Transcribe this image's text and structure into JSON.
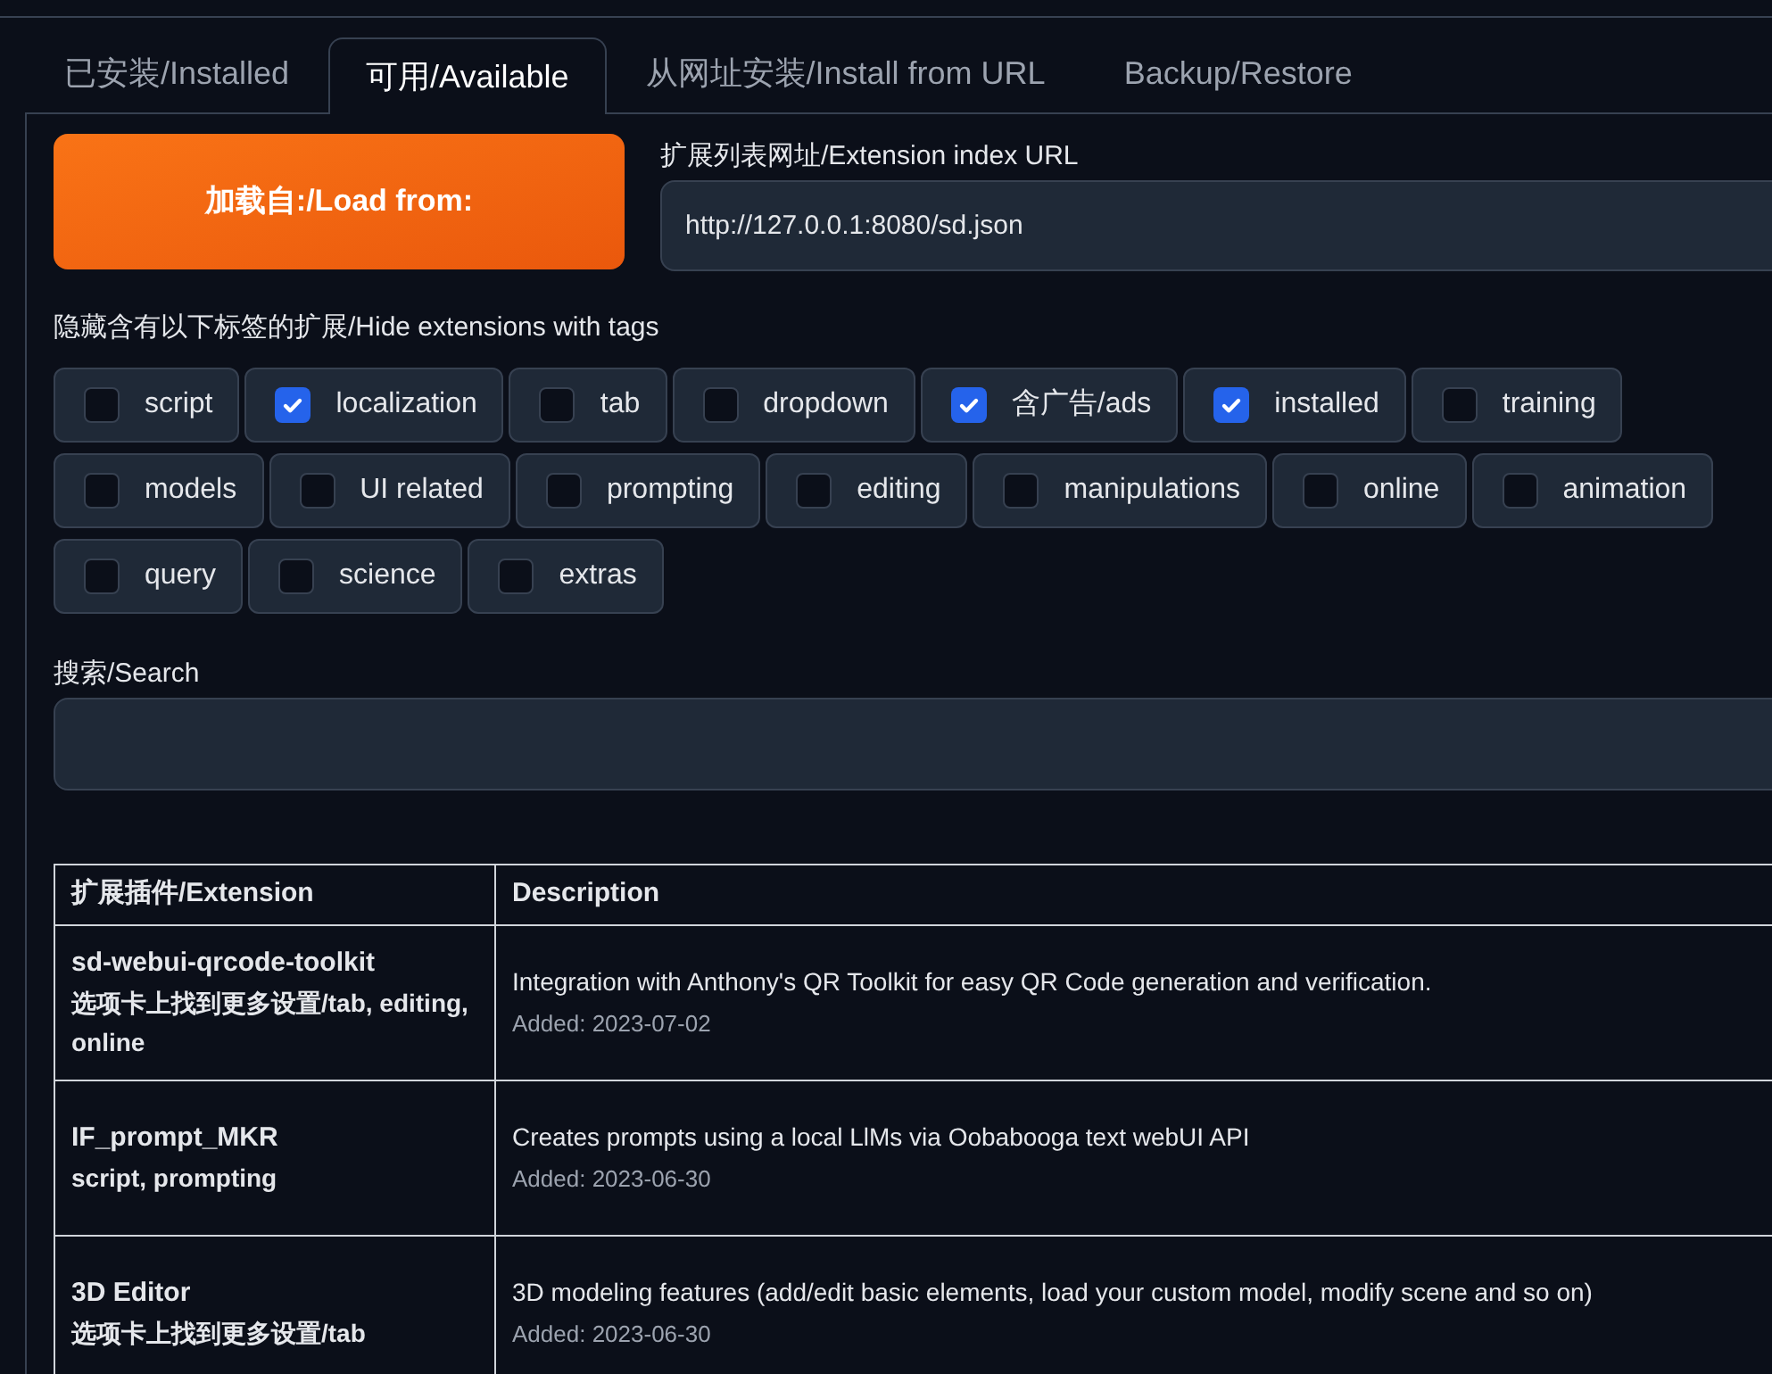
{
  "tabs": [
    {
      "label": "已安装/Installed",
      "selected": false
    },
    {
      "label": "可用/Available",
      "selected": true
    },
    {
      "label": "从网址安装/Install from URL",
      "selected": false
    },
    {
      "label": "Backup/Restore",
      "selected": false
    }
  ],
  "load_button": "加载自:/Load from:",
  "index_url": {
    "label": "扩展列表网址/Extension index URL",
    "value": "http://127.0.0.1:8080/sd.json"
  },
  "hide_tags": {
    "label": "隐藏含有以下标签的扩展/Hide extensions with tags",
    "rows": [
      [
        {
          "label": "script",
          "checked": false
        },
        {
          "label": "localization",
          "checked": true
        },
        {
          "label": "tab",
          "checked": false
        },
        {
          "label": "dropdown",
          "checked": false
        },
        {
          "label": "含广告/ads",
          "checked": true
        },
        {
          "label": "installed",
          "checked": true
        },
        {
          "label": "training",
          "checked": false
        }
      ],
      [
        {
          "label": "models",
          "checked": false
        },
        {
          "label": "UI related",
          "checked": false
        },
        {
          "label": "prompting",
          "checked": false
        },
        {
          "label": "editing",
          "checked": false
        },
        {
          "label": "manipulations",
          "checked": false
        },
        {
          "label": "online",
          "checked": false
        },
        {
          "label": "animation",
          "checked": false
        }
      ],
      [
        {
          "label": "query",
          "checked": false
        },
        {
          "label": "science",
          "checked": false
        },
        {
          "label": "extras",
          "checked": false
        }
      ]
    ]
  },
  "search": {
    "label": "搜索/Search"
  },
  "table": {
    "columns": [
      "扩展插件/Extension",
      "Description"
    ],
    "rows": [
      {
        "name": "sd-webui-qrcode-toolkit",
        "tags": "选项卡上找到更多设置/tab, editing, online",
        "description": "Integration with Anthony's QR Toolkit for easy QR Code generation and verification.",
        "added": "Added: 2023-07-02"
      },
      {
        "name": "IF_prompt_MKR",
        "tags": "script, prompting",
        "description": "Creates prompts using a local LlMs via Oobabooga text webUI API",
        "added": "Added: 2023-06-30"
      },
      {
        "name": "3D Editor",
        "tags": "选项卡上找到更多设置/tab",
        "description": "3D modeling features (add/edit basic elements, load your custom model, modify scene and so on)",
        "added": "Added: 2023-06-30"
      }
    ]
  }
}
